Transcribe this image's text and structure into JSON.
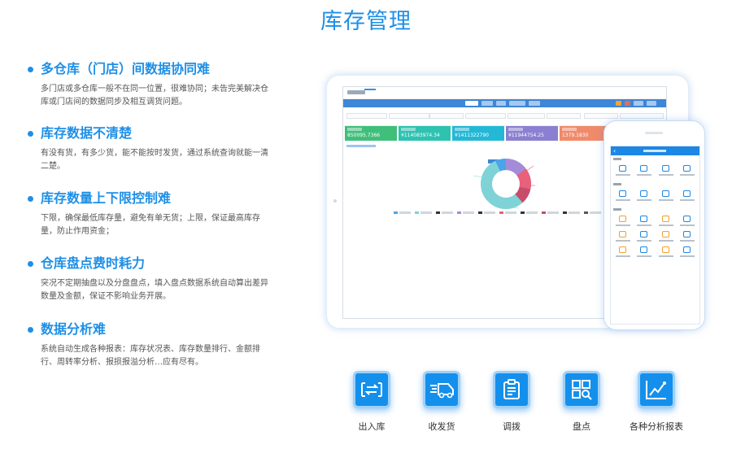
{
  "title": "库存管理",
  "features": [
    {
      "heading": "多仓库（门店）间数据协同难",
      "body": "多门店或多仓库一般不在同一位置，很难协同；未告完美解决仓库或门店间的数据同步及相互调货问题。"
    },
    {
      "heading": "库存数据不清楚",
      "body": "有没有货，有多少货，能不能按时发货，通过系统查询就能一清二楚。"
    },
    {
      "heading": "库存数量上下限控制难",
      "body": "下限，确保最低库存量，避免有单无货；上限，保证最高库存量，防止作用资金；"
    },
    {
      "heading": "仓库盘点费时耗力",
      "body": "突况不定期抽盘以及分盘盘点，填入盘点数据系统自动算出差异数量及金额，保证不影响业务开展。"
    },
    {
      "heading": "数据分析难",
      "body": "系统自动生成各种报表：库存状况表、库存数量排行、金额排行、周转率分析、报损报溢分析…应有尽有。"
    }
  ],
  "dashboard": {
    "cards": [
      {
        "value": "850095.7366",
        "color": "#3fbf7a"
      },
      {
        "value": "¥114083974.34",
        "color": "#2ec2b1"
      },
      {
        "value": "¥1411322790",
        "color": "#23b8d6"
      },
      {
        "value": "¥11944754.25",
        "color": "#8a7fd0"
      },
      {
        "value": "1379.1830",
        "color": "#f08a6a"
      }
    ]
  },
  "phone": {
    "back": "‹"
  },
  "icons": [
    {
      "label": "出入库",
      "icon": "transfer-arrows-icon"
    },
    {
      "label": "收发货",
      "icon": "delivery-truck-icon"
    },
    {
      "label": "调拨",
      "icon": "clipboard-icon"
    },
    {
      "label": "盘点",
      "icon": "inventory-scan-icon"
    },
    {
      "label": "各种分析报表",
      "icon": "line-chart-icon"
    }
  ],
  "colors": {
    "accent": "#1f8fe6",
    "icon_bg": "#1490ec"
  }
}
